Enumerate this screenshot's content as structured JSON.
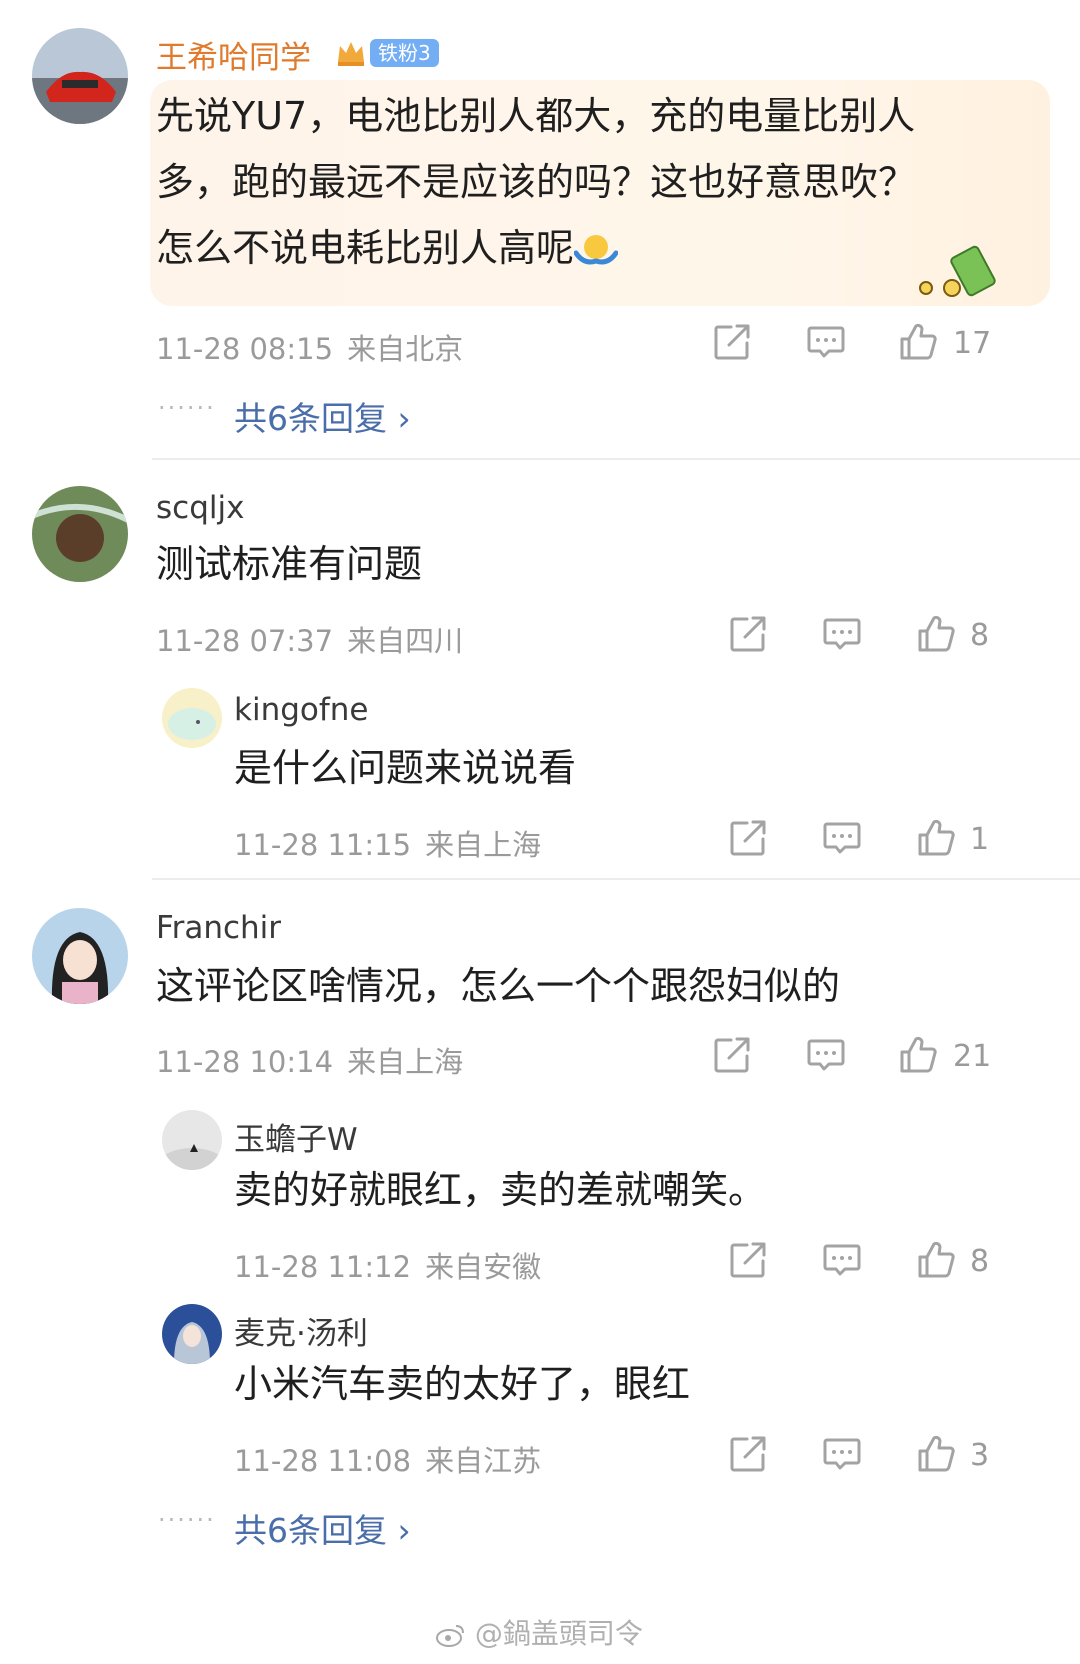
{
  "comments": [
    {
      "user": "王希哈同学",
      "badge": "铁粉3",
      "lines": [
        "先说YU7，电池比别人都大，充的电量比别人",
        "多，跑的最远不是应该的吗？这也好意思吹？",
        "怎么不说电耗比别人高呢"
      ],
      "time": "11-28 08:15",
      "location": "来自北京",
      "likes": "17",
      "replies_link": "共6条回复 ›"
    },
    {
      "user": "scqljx",
      "lines": [
        "测试标准有问题"
      ],
      "time": "11-28 07:37",
      "location": "来自四川",
      "likes": "8",
      "replies": [
        {
          "user": "kingofne",
          "lines": [
            "是什么问题来说说看"
          ],
          "time": "11-28 11:15",
          "location": "来自上海",
          "likes": "1"
        }
      ]
    },
    {
      "user": "Franchir",
      "lines": [
        "这评论区啥情况，怎么一个个跟怨妇似的"
      ],
      "time": "11-28 10:14",
      "location": "来自上海",
      "likes": "21",
      "replies": [
        {
          "user": "玉蟾子W",
          "lines": [
            "卖的好就眼红，卖的差就嘲笑。"
          ],
          "time": "11-28 11:12",
          "location": "来自安徽",
          "likes": "8"
        },
        {
          "user": "麦克·汤利",
          "lines": [
            "小米汽车卖的太好了，眼红"
          ],
          "time": "11-28 11:08",
          "location": "来自江苏",
          "likes": "3"
        }
      ],
      "replies_link": "共6条回复 ›"
    }
  ],
  "watermark": "@鍋盖頭司令",
  "dots": "······",
  "colors": {
    "username_highlight": "#e07a2c",
    "link_blue": "#4a6ea9",
    "meta_gray": "#9a9a9a",
    "badge_blue": "#73aef4"
  },
  "icons": [
    "share-icon",
    "comment-icon",
    "like-icon",
    "shrug-emoji-icon",
    "money-decoration-icon",
    "crown-icon",
    "weibo-logo-icon"
  ]
}
